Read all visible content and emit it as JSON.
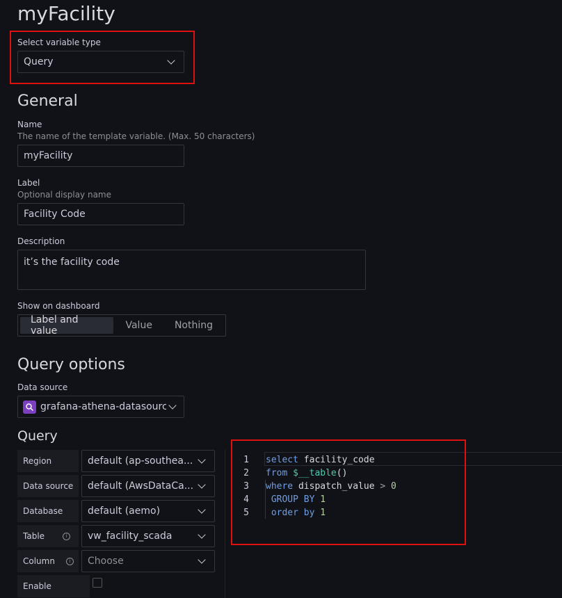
{
  "page": {
    "title": "myFacility"
  },
  "variable_type": {
    "label": "Select variable type",
    "value": "Query"
  },
  "general": {
    "heading": "General",
    "name": {
      "label": "Name",
      "description": "The name of the template variable. (Max. 50 characters)",
      "value": "myFacility"
    },
    "display_label": {
      "label": "Label",
      "description": "Optional display name",
      "value": "Facility Code"
    },
    "description": {
      "label": "Description",
      "value": "it’s the facility code"
    },
    "show_on_dashboard": {
      "label": "Show on dashboard",
      "options": [
        "Label and value",
        "Value",
        "Nothing"
      ],
      "selected": "Label and value"
    }
  },
  "query_options": {
    "heading": "Query options",
    "data_source": {
      "label": "Data source",
      "value": "grafana-athena-datasource"
    }
  },
  "query": {
    "heading": "Query",
    "fields": {
      "region": {
        "label": "Region",
        "value": "default (ap-southea..."
      },
      "data_source": {
        "label": "Data source",
        "value": "default (AwsDataCa..."
      },
      "database": {
        "label": "Database",
        "value": "default (aemo)"
      },
      "table": {
        "label": "Table",
        "value": "vw_facility_scada"
      },
      "column": {
        "label": "Column",
        "placeholder": "Choose"
      },
      "enable": {
        "label": "Enable"
      }
    },
    "code": {
      "line_numbers": [
        "1",
        "2",
        "3",
        "4",
        "5"
      ],
      "l1": {
        "kw": "select",
        "rest": " facility_code"
      },
      "l2": {
        "kw": "from",
        "fn": " $__table",
        "rest": "()"
      },
      "l3": {
        "kw": "where",
        "rest": " dispatch_value",
        "op": " >",
        "num": " 0"
      },
      "l4": {
        "kw": " GROUP BY",
        "num": " 1"
      },
      "l5": {
        "kw": " order by",
        "num": " 1"
      }
    }
  },
  "colors": {
    "highlight_box": "#e01010",
    "keyword": "#6f9ee3",
    "background": "#111217"
  }
}
